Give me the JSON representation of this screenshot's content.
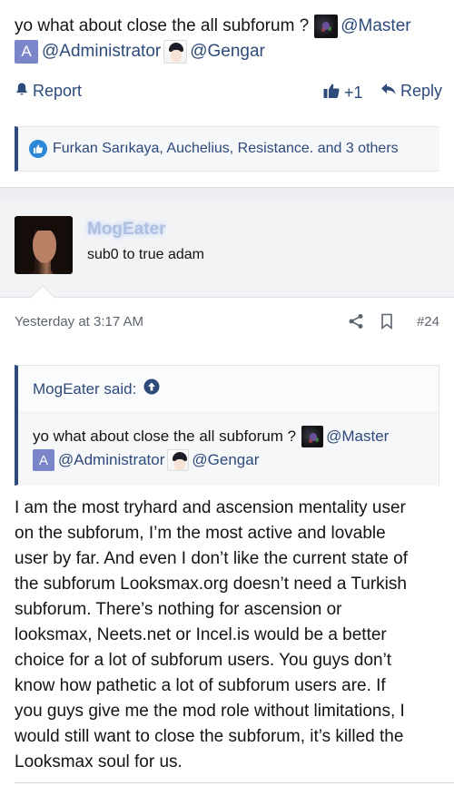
{
  "post1": {
    "line1_text": "yo what about close the all subforum ?",
    "mention_master": "@Master",
    "letter_avatar": "A",
    "mention_admin": "@Administrator",
    "mention_gengar": "@Gengar",
    "report_label": "Report",
    "like_count": "+1",
    "reply_label": "Reply",
    "reactions_text": "Furkan Sarıkaya, Auchelius, Resistance. and 3 others"
  },
  "post2": {
    "username": "MogEater",
    "user_title": "sub0 to true adam",
    "timestamp": "Yesterday at 3:17 AM",
    "post_number": "#24",
    "quote": {
      "author_said": "MogEater said:",
      "line1_text": "yo what about close the all subforum ?",
      "mention_master": "@Master",
      "letter_avatar": "A",
      "mention_admin": "@Administrator",
      "mention_gengar": "@Gengar"
    },
    "body_lines": [
      "I am the most tryhard and ascension mentality user",
      "on the subforum, I’m the most active and lovable",
      "user by far. And even I don’t like the current state of",
      "the subforum Looksmax.org doesn’t need a Turkish",
      "subforum. There’s nothing for ascension or",
      "looksmax, Neets.net or Incel.is would be a better",
      "choice for a lot of subforum users. You guys don’t",
      "know how pathetic a lot of subforum users are. If",
      "you guys give me the mod role without limitations, I",
      "would still want to close the subforum, it’s killed the",
      "Looksmax soul for us."
    ]
  },
  "colors": {
    "link": "#2d4a7a",
    "like_badge": "#2e88d8",
    "letter_avatar_bg": "#7a86c9",
    "username_glow": "#aebfe0"
  },
  "icons": [
    "bell-icon",
    "thumbs-up-icon",
    "reply-arrow-icon",
    "like-badge-icon",
    "share-icon",
    "bookmark-icon",
    "arrow-up-circle-icon"
  ]
}
